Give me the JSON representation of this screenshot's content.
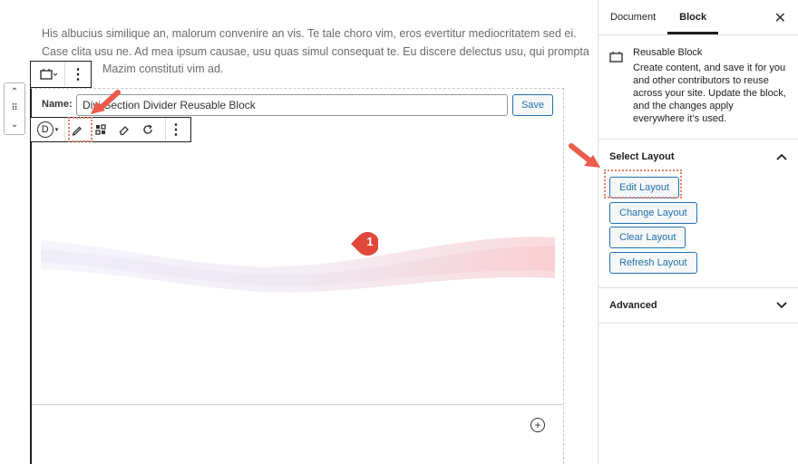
{
  "paragraph": {
    "line1": "His albucius similique an, malorum convenire an vis. Te tale choro vim, eros evertitur mediocritatem sed ei.",
    "line2": "Case clita usu ne. Ad mea ipsum causae, usu quas simul consequat te. Eu discere delectus usu, qui prompta",
    "line3": "Mazim constituti vim ad."
  },
  "block_toolbar": {
    "block_type_icon": "reusable-block-icon",
    "more_icon": "vertical-ellipsis-icon",
    "more_label": "⋮"
  },
  "mover": {
    "up": "⌃",
    "drag": "⠿",
    "down": "⌄"
  },
  "reusable": {
    "name_label": "Name:",
    "name_value": "Divi Section Divider Reusable Block",
    "save_label": "Save"
  },
  "divi_toolbar": {
    "logo": "D",
    "caret": "▾",
    "icons": [
      "pencil-icon",
      "layout-icon",
      "eraser-icon",
      "refresh-icon"
    ],
    "more_label": "⋮"
  },
  "annotation": {
    "marker": "1"
  },
  "add_block": "+",
  "sidebar": {
    "tabs": [
      "Document",
      "Block"
    ],
    "active_tab": "Block",
    "close": "✕",
    "block_card": {
      "title": "Reusable Block",
      "description": "Create content, and save it for you and other contributors to reuse across your site. Update the block, and the changes apply everywhere it’s used."
    },
    "select_layout": {
      "title": "Select Layout",
      "buttons": [
        "Edit Layout",
        "Change Layout",
        "Clear Layout",
        "Refresh Layout"
      ]
    },
    "advanced": {
      "title": "Advanced"
    }
  },
  "colors": {
    "accent": "#2271b1",
    "highlight": "#f07f6a"
  }
}
